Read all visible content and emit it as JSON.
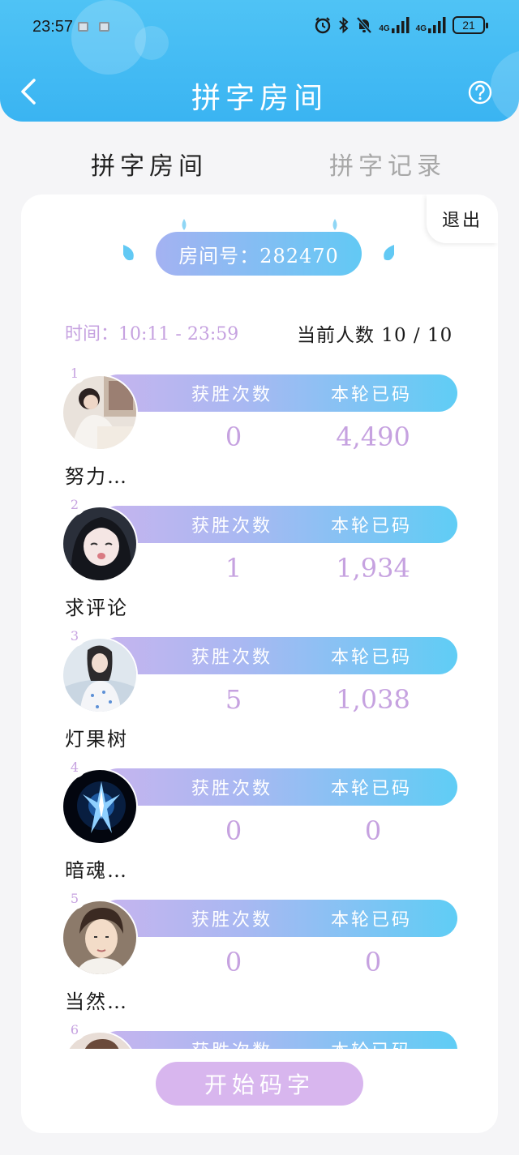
{
  "status_bar": {
    "time": "23:57",
    "network_1": "4G",
    "network_2": "4G",
    "battery": "21"
  },
  "header": {
    "title": "拼字房间"
  },
  "tabs": [
    {
      "label": "拼字房间",
      "active": true
    },
    {
      "label": "拼字记录",
      "active": false
    }
  ],
  "room": {
    "exit_label": "退出",
    "room_number_text": "房间号：282470",
    "time_text": "时间：10:11 - 23:59",
    "count_text": "当前人数 10 / 10"
  },
  "players": [
    {
      "rank": "1",
      "wins_label": "获胜次数",
      "words_label": "本轮已码",
      "wins": "0",
      "words": "4,490",
      "name": "努力…"
    },
    {
      "rank": "2",
      "wins_label": "获胜次数",
      "words_label": "本轮已码",
      "wins": "1",
      "words": "1,934",
      "name": "求评论"
    },
    {
      "rank": "3",
      "wins_label": "获胜次数",
      "words_label": "本轮已码",
      "wins": "5",
      "words": "1,038",
      "name": "灯果树"
    },
    {
      "rank": "4",
      "wins_label": "获胜次数",
      "words_label": "本轮已码",
      "wins": "0",
      "words": "0",
      "name": "暗魂…"
    },
    {
      "rank": "5",
      "wins_label": "获胜次数",
      "words_label": "本轮已码",
      "wins": "0",
      "words": "0",
      "name": "当然…"
    },
    {
      "rank": "6",
      "wins_label": "获胜次数",
      "words_label": "本轮已码",
      "wins": "",
      "words": "",
      "name": ""
    }
  ],
  "start_button": "开始码字",
  "colors": {
    "header_blue": "#3ab4f2",
    "accent_purple": "#c6a2e0",
    "button_purple": "#d8b6ee"
  },
  "icons": {
    "back": "chevron-left-icon",
    "help": "question-circle-icon",
    "alarm": "alarm-icon",
    "bluetooth": "bluetooth-icon",
    "mute": "bell-off-icon",
    "signal": "signal-icon",
    "battery": "battery-icon"
  }
}
